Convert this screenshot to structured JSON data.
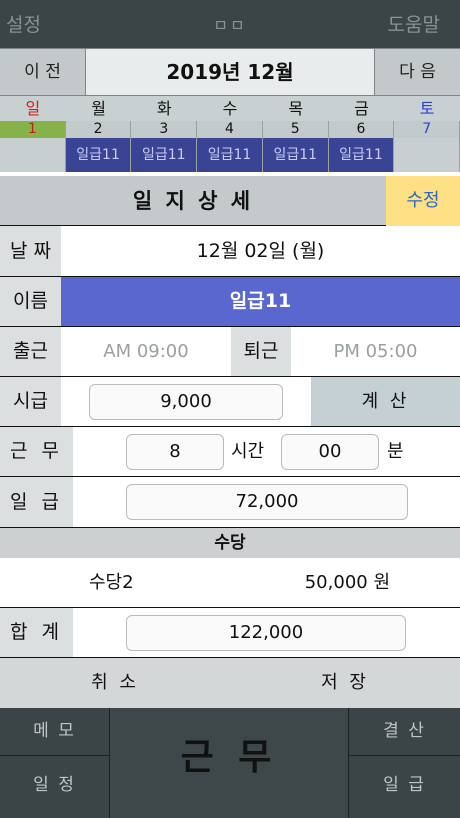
{
  "topbar": {
    "left_label": "설정",
    "center_label": "ㅁㅁ",
    "right_label": "도움말"
  },
  "month_nav": {
    "prev_label": "이 전",
    "title": "2019년 12월",
    "next_label": "다 음"
  },
  "weekdays": [
    "일",
    "월",
    "화",
    "수",
    "목",
    "금",
    "토"
  ],
  "dates": [
    "1",
    "2",
    "3",
    "4",
    "5",
    "6",
    "7"
  ],
  "shifts": [
    "",
    "일급11",
    "일급11",
    "일급11",
    "일급11",
    "일급11",
    ""
  ],
  "detail": {
    "title": "일 지 상 세",
    "edit_label": "수정",
    "date_label": "날 짜",
    "date_value": "12월 02일 (월)",
    "name_label": "이름",
    "name_value": "일급11",
    "clock_in_label": "출근",
    "clock_in_value": "AM 09:00",
    "clock_out_label": "퇴근",
    "clock_out_value": "PM 05:00",
    "hourly_label": "시급",
    "hourly_value": "9,000",
    "calc_label": "계 산",
    "work_label": "근 무",
    "work_hours": "8",
    "hours_unit": "시간",
    "work_minutes": "00",
    "minutes_unit": "분",
    "daily_label": "일 급",
    "daily_value": "72,000",
    "allowance_header": "수당",
    "allowance_name": "수당2",
    "allowance_amount": "50,000 원",
    "total_label": "합 계",
    "total_value": "122,000",
    "cancel_label": "취 소",
    "save_label": "저 장"
  },
  "bottombar": {
    "memo_label": "메 모",
    "schedule_label": "일 정",
    "work_label": "근 무",
    "settle_label": "결 산",
    "daily_label": "일 급"
  },
  "colors": {
    "dark_bar": "#3b4446",
    "accent_blue": "#5a67cf",
    "edit_yellow": "#fde083",
    "sunday_red": "#d42020",
    "saturday_blue": "#2a3fd9",
    "shift_cell": "#3a4495"
  }
}
